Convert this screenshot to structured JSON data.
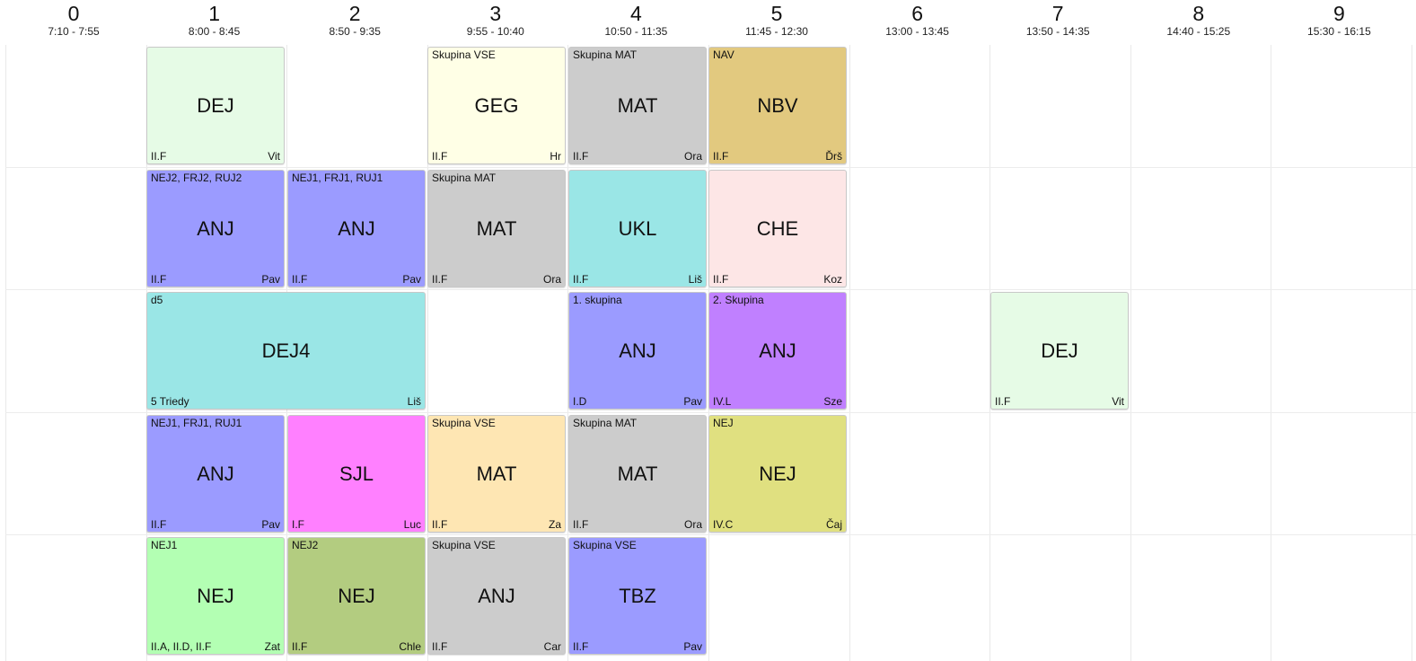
{
  "periods": [
    {
      "num": "0",
      "time": "7:10 - 7:55"
    },
    {
      "num": "1",
      "time": "8:00 - 8:45"
    },
    {
      "num": "2",
      "time": "8:50 - 9:35"
    },
    {
      "num": "3",
      "time": "9:55 - 10:40"
    },
    {
      "num": "4",
      "time": "10:50 - 11:35"
    },
    {
      "num": "5",
      "time": "11:45 - 12:30"
    },
    {
      "num": "6",
      "time": "13:00 - 13:45"
    },
    {
      "num": "7",
      "time": "13:50 - 14:35"
    },
    {
      "num": "8",
      "time": "14:40 - 15:25"
    },
    {
      "num": "9",
      "time": "15:30 - 16:15"
    }
  ],
  "lessons": [
    {
      "day": 0,
      "period": 1,
      "span": 1,
      "group": "",
      "subject": "DEJ",
      "cls": "II.F",
      "teacher": "Vit",
      "color": "#e6fbe6"
    },
    {
      "day": 0,
      "period": 3,
      "span": 1,
      "group": "Skupina VSE",
      "subject": "GEG",
      "cls": "II.F",
      "teacher": "Hr",
      "color": "#ffffe6"
    },
    {
      "day": 0,
      "period": 4,
      "span": 1,
      "group": "Skupina MAT",
      "subject": "MAT",
      "cls": "II.F",
      "teacher": "Ora",
      "color": "#cccccc"
    },
    {
      "day": 0,
      "period": 5,
      "span": 1,
      "group": "NAV",
      "subject": "NBV",
      "cls": "II.F",
      "teacher": "Ďrš",
      "color": "#e2c97f"
    },
    {
      "day": 1,
      "period": 1,
      "span": 1,
      "group": "NEJ2, FRJ2, RUJ2",
      "subject": "ANJ",
      "cls": "II.F",
      "teacher": "Pav",
      "color": "#9b9bff"
    },
    {
      "day": 1,
      "period": 2,
      "span": 1,
      "group": "NEJ1, FRJ1, RUJ1",
      "subject": "ANJ",
      "cls": "II.F",
      "teacher": "Pav",
      "color": "#9b9bff"
    },
    {
      "day": 1,
      "period": 3,
      "span": 1,
      "group": "Skupina MAT",
      "subject": "MAT",
      "cls": "II.F",
      "teacher": "Ora",
      "color": "#cccccc"
    },
    {
      "day": 1,
      "period": 4,
      "span": 1,
      "group": "",
      "subject": "UKL",
      "cls": "II.F",
      "teacher": "Liš",
      "color": "#9ae6e6"
    },
    {
      "day": 1,
      "period": 5,
      "span": 1,
      "group": "",
      "subject": "CHE",
      "cls": "II.F",
      "teacher": "Koz",
      "color": "#fde6e6"
    },
    {
      "day": 2,
      "period": 1,
      "span": 2,
      "group": "d5",
      "subject": "DEJ4",
      "cls": "5 Triedy",
      "teacher": "Liš",
      "color": "#9ae6e6"
    },
    {
      "day": 2,
      "period": 4,
      "span": 1,
      "group": "1. skupina",
      "subject": "ANJ",
      "cls": "I.D",
      "teacher": "Pav",
      "color": "#9b9bff"
    },
    {
      "day": 2,
      "period": 5,
      "span": 1,
      "group": "2. Skupina",
      "subject": "ANJ",
      "cls": "IV.L",
      "teacher": "Sze",
      "color": "#c080ff"
    },
    {
      "day": 2,
      "period": 7,
      "span": 1,
      "group": "",
      "subject": "DEJ",
      "cls": "II.F",
      "teacher": "Vit",
      "color": "#e6fbe6"
    },
    {
      "day": 3,
      "period": 1,
      "span": 1,
      "group": "NEJ1, FRJ1, RUJ1",
      "subject": "ANJ",
      "cls": "II.F",
      "teacher": "Pav",
      "color": "#9b9bff"
    },
    {
      "day": 3,
      "period": 2,
      "span": 1,
      "group": "",
      "subject": "SJL",
      "cls": "I.F",
      "teacher": "Luc",
      "color": "#ff80ff"
    },
    {
      "day": 3,
      "period": 3,
      "span": 1,
      "group": "Skupina VSE",
      "subject": "MAT",
      "cls": "II.F",
      "teacher": "Za",
      "color": "#fee6b3"
    },
    {
      "day": 3,
      "period": 4,
      "span": 1,
      "group": "Skupina MAT",
      "subject": "MAT",
      "cls": "II.F",
      "teacher": "Ora",
      "color": "#cccccc"
    },
    {
      "day": 3,
      "period": 5,
      "span": 1,
      "group": "NEJ",
      "subject": "NEJ",
      "cls": "IV.C",
      "teacher": "Čaj",
      "color": "#e0e080"
    },
    {
      "day": 4,
      "period": 1,
      "span": 1,
      "group": "NEJ1",
      "subject": "NEJ",
      "cls": "II.A, II.D, II.F",
      "teacher": "Zat",
      "color": "#b3ffb3"
    },
    {
      "day": 4,
      "period": 2,
      "span": 1,
      "group": "NEJ2",
      "subject": "NEJ",
      "cls": "II.F",
      "teacher": "Chle",
      "color": "#b3cc80"
    },
    {
      "day": 4,
      "period": 3,
      "span": 1,
      "group": "Skupina VSE",
      "subject": "ANJ",
      "cls": "II.F",
      "teacher": "Car",
      "color": "#cccccc"
    },
    {
      "day": 4,
      "period": 4,
      "span": 1,
      "group": "Skupina VSE",
      "subject": "TBZ",
      "cls": "II.F",
      "teacher": "Pav",
      "color": "#9b9bff"
    }
  ]
}
